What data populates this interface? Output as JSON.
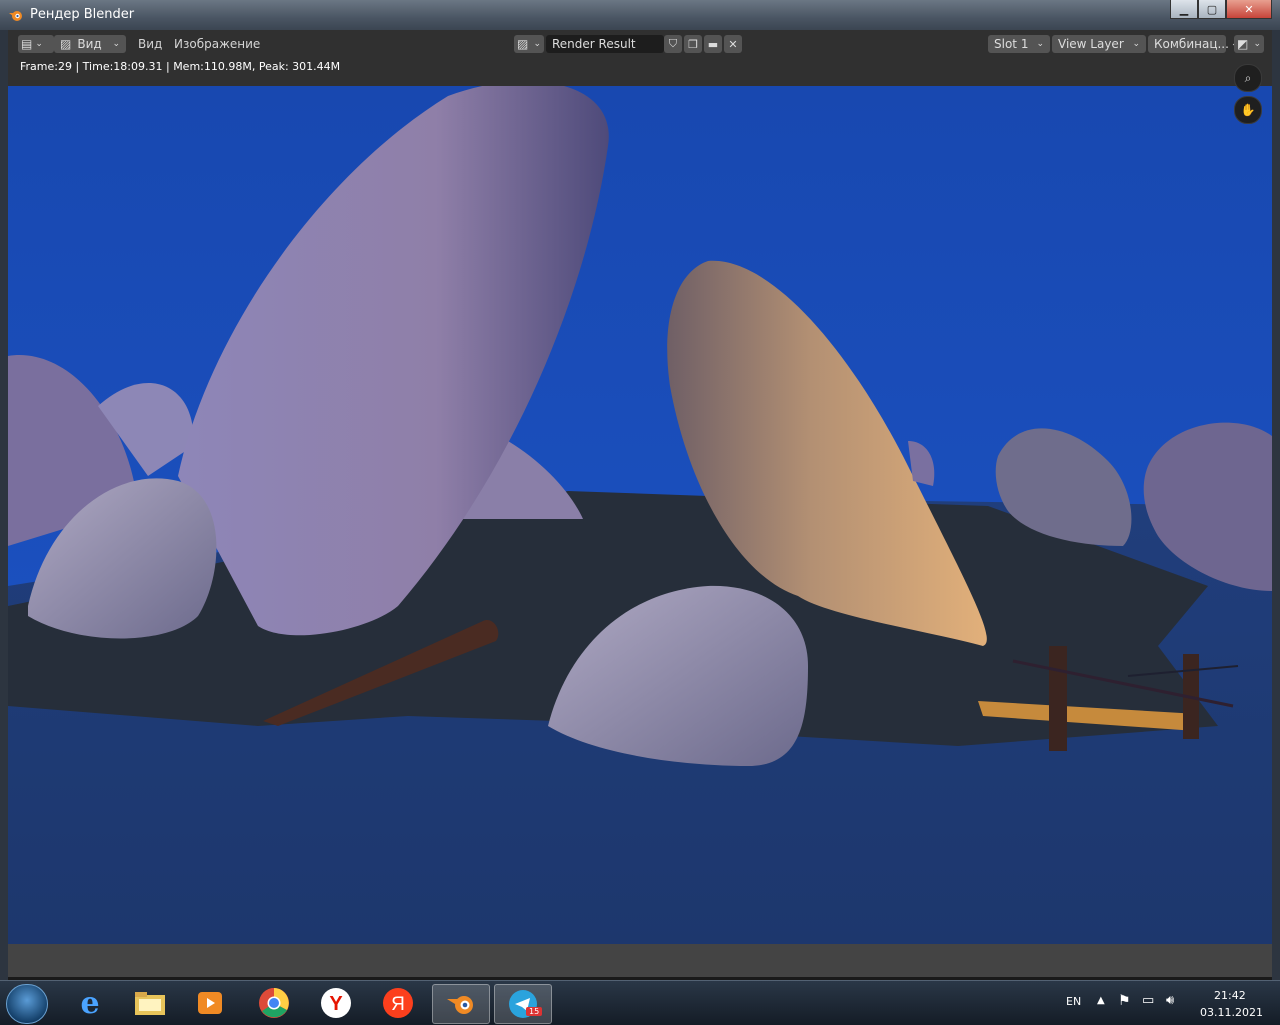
{
  "window": {
    "title": "Рендер Blender"
  },
  "header": {
    "view_menu_dropdown": "Вид",
    "menu_view": "Вид",
    "menu_image": "Изображение",
    "image_name": "Render Result",
    "slot": "Slot 1",
    "view_layer": "View Layer",
    "pass": "Комбинац..."
  },
  "status": {
    "text": "Frame:29 | Time:18:09.31 | Mem:110.98M, Peak: 301.44M"
  },
  "taskbar": {
    "lang": "EN",
    "time": "21:42",
    "date": "03.11.2021",
    "telegram_badge": "15",
    "apps": [
      "start-orb",
      "internet-explorer",
      "file-explorer",
      "media-player",
      "chrome",
      "yandex-browser",
      "yandex",
      "blender",
      "telegram"
    ]
  },
  "colors": {
    "sky": "#1a4bb8",
    "ground": "#1f3c78",
    "blender_header": "#303030"
  }
}
